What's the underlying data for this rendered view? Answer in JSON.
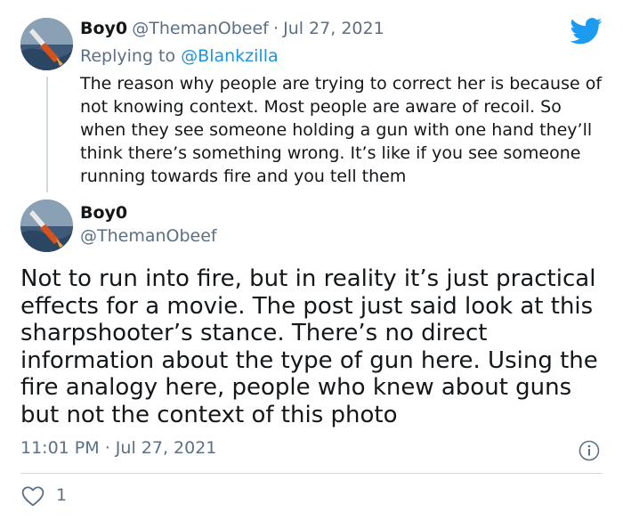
{
  "colors": {
    "text": "#14171a",
    "secondary": "#5b7083",
    "accent": "#1b95e0",
    "border": "#cfd9de",
    "twitter_blue": "#1d9bf0"
  },
  "parent": {
    "display_name": "Boy0",
    "handle": "@ThemanObeef",
    "separator": "·",
    "date": "Jul 27, 2021",
    "replying_prefix": "Replying to",
    "replying_to": "@Blankzilla",
    "text": "The reason why people are trying to correct her is because of not knowing context. Most people are aware of recoil. So when they see someone holding a gun with one hand they’ll think there’s something wrong. It’s like if you see someone running towards fire and you tell them"
  },
  "main": {
    "display_name": "Boy0",
    "handle": "@ThemanObeef",
    "text": "Not to run into fire, but in reality it’s just practical effects for a movie. The post just said look at this sharpshooter’s stance. There’s no direct information about the type of gun here. Using the fire analogy here, people who knew about guns but not the context of this photo",
    "time": "11:01 PM",
    "separator": "·",
    "date": "Jul 27, 2021",
    "like_count": "1"
  },
  "icons": {
    "logo": "twitter-bird-icon",
    "info": "info-icon",
    "like": "heart-icon"
  }
}
